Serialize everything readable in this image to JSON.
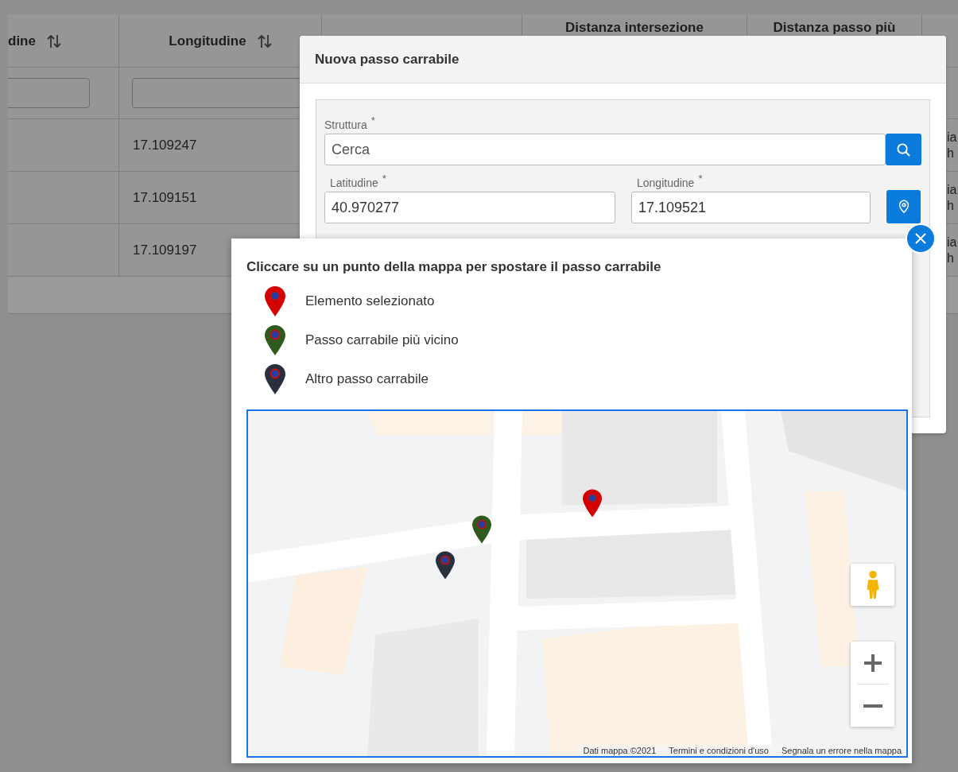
{
  "table": {
    "columns": [
      {
        "kind": "text",
        "label": "dine",
        "sort": true
      },
      {
        "kind": "text",
        "label": "Longitudine",
        "sort": true
      },
      {
        "kind": "empty"
      },
      {
        "kind": "text",
        "label": "Distanza intersezione",
        "sort": false
      },
      {
        "kind": "text",
        "label": "Distanza passo più",
        "sort": false
      },
      {
        "kind": "empty"
      }
    ],
    "rows": [
      {
        "longitudine": "17.109247",
        "column_6": [
          "ia",
          "h"
        ]
      },
      {
        "longitudine": "17.109151",
        "column_6": [
          "ia",
          "h"
        ]
      },
      {
        "longitudine": "17.109197",
        "column_6": [
          "ia",
          "h"
        ]
      }
    ]
  },
  "dialog": {
    "title": "Nuova passo carrabile",
    "struttura": {
      "label": "Struttura",
      "mark": "*",
      "placeholder": "Cerca"
    },
    "latitudine": {
      "label": "Latitudine",
      "mark": "*",
      "value": "40.970277"
    },
    "longitudine": {
      "label": "Longitudine",
      "mark": "*",
      "value": "17.109521"
    }
  },
  "map_popup": {
    "instruction": "Cliccare su un punto della mappa per spostare il passo carrabile",
    "legend": [
      {
        "label": "Elemento selezionato",
        "color": "#d50000"
      },
      {
        "label": "Passo carrabile più vicino",
        "color": "#2f5a1e"
      },
      {
        "label": "Altro passo carrabile",
        "color": "#283040"
      }
    ],
    "map": {
      "kind": "picture",
      "markers": [
        {
          "color": "#d50000"
        },
        {
          "color": "#2f5a1e"
        },
        {
          "color": "#283040"
        }
      ],
      "attribution": [
        "Dati mappa ©2021",
        "Termini e condizioni d'uso",
        "Segnala un errore nella mappa"
      ]
    }
  }
}
